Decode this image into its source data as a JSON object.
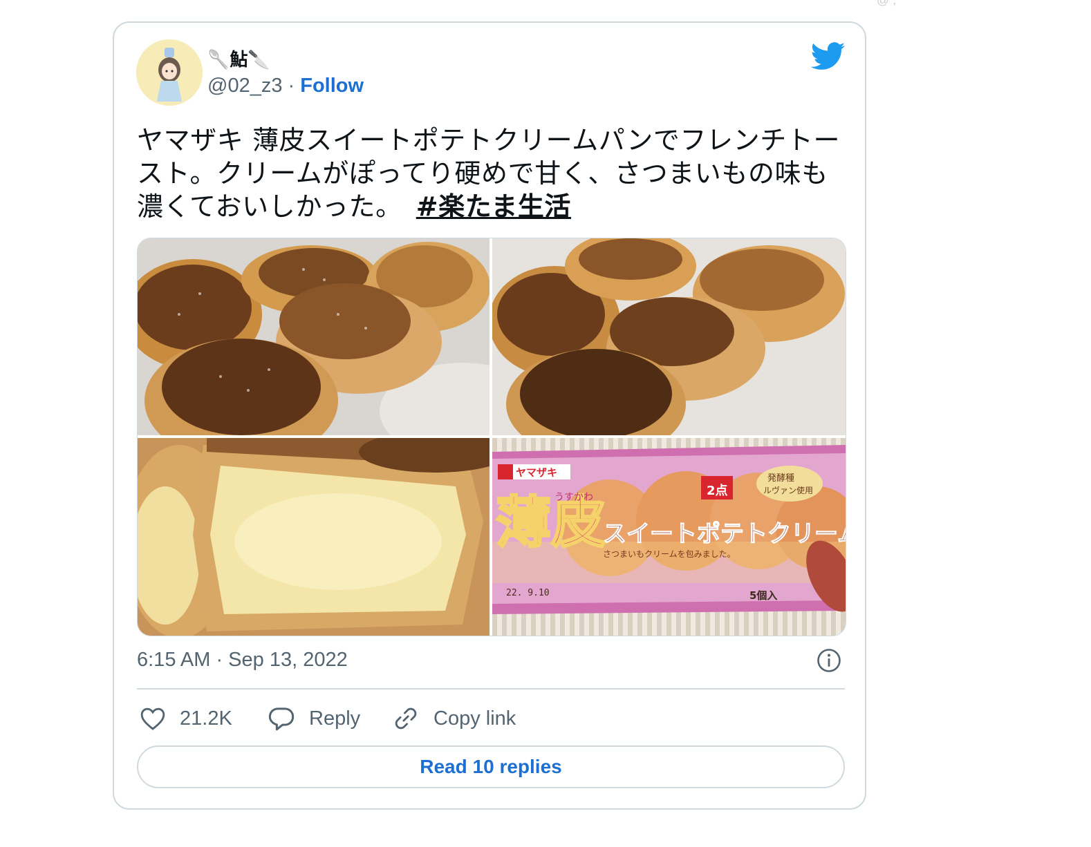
{
  "page": {
    "corner_fragment": "@ ,"
  },
  "tweet": {
    "author": {
      "display_name": "🥄鮎🔪",
      "handle": "@02_z3",
      "separator": "·",
      "follow_label": "Follow"
    },
    "text": "ヤマザキ 薄皮スイートポテトクリームパンでフレンチトースト。クリームがぽってり硬めで甘く、さつまいもの味も濃くておいしかった。",
    "hashtag": "#楽たま生活",
    "media": [
      {
        "description": "powdered-sugar-french-toast"
      },
      {
        "description": "french-toast-plate"
      },
      {
        "description": "cross-section-cream"
      },
      {
        "description": "product-package"
      }
    ],
    "package_text": {
      "brand": "ヤマザキ",
      "big_chars": "薄皮",
      "ruby": "うすかわ",
      "product_name": "スイートポテトクリームパン",
      "tagline": "さつまいもクリームを包みました。",
      "count": "5個入",
      "points": "2点",
      "yeast": "発酵種",
      "levain": "ルヴァン使用",
      "date": "22. 9.10"
    },
    "timestamp": "6:15 AM · Sep 13, 2022",
    "actions": {
      "like_count": "21.2K",
      "reply_label": "Reply",
      "copy_label": "Copy link"
    },
    "read_replies_label": "Read 10 replies",
    "colors": {
      "brand_blue": "#1d9bf0",
      "link_blue": "#1d6fd1",
      "secondary_text": "#536471",
      "border": "#cfd9de"
    },
    "icons": [
      "twitter-bird-icon",
      "info-icon",
      "heart-icon",
      "reply-bubble-icon",
      "link-icon"
    ]
  }
}
